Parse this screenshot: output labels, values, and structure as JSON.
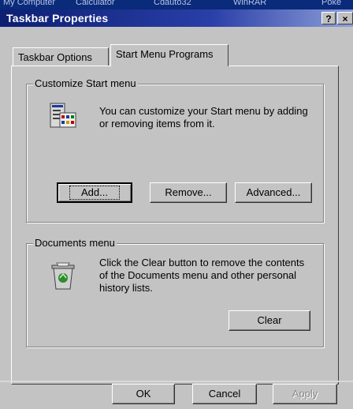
{
  "taskbar_strip": [
    "My Computer",
    "Calculator",
    "Cdauto32",
    "WinRAR",
    "Poke"
  ],
  "window": {
    "title": "Taskbar Properties",
    "help_button": "?",
    "close_button": "×"
  },
  "tabs": [
    {
      "label": "Taskbar Options"
    },
    {
      "label": "Start Menu Programs"
    }
  ],
  "customize": {
    "legend": "Customize Start menu",
    "description": "You can customize your Start menu by adding or removing items from it.",
    "add": "Add...",
    "remove": "Remove...",
    "advanced": "Advanced..."
  },
  "documents": {
    "legend": "Documents menu",
    "description": "Click the Clear button to remove the contents of the Documents menu and other personal history lists.",
    "clear": "Clear"
  },
  "footer": {
    "ok": "OK",
    "cancel": "Cancel",
    "apply": "Apply"
  }
}
